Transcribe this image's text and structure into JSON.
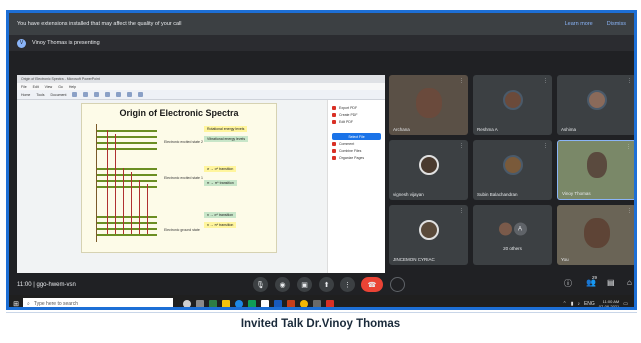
{
  "extension_bar": {
    "message": "You have extensions installed that may affect the quality of your call",
    "learn_more": "Learn more",
    "dismiss": "Dismiss"
  },
  "presenting_bar": {
    "text": "Vinoy Thomas is presenting",
    "avatar_letter": "V"
  },
  "shared_window": {
    "title": "Origin of Electronic Spectra - Microsoft PowerPoint",
    "menu": [
      "File",
      "Edit",
      "View",
      "Go",
      "Help"
    ],
    "ribbon": [
      "Home",
      "Tools",
      "Document"
    ],
    "slide_title": "Origin of Electronic Spectra",
    "tags": [
      "Rotational energy levels",
      "Vibrational energy levels",
      "σ → σ* transition",
      "π → π* transition",
      "n → σ* transition",
      "n → π* transition"
    ],
    "state_labels": [
      "Electronic excited state 2",
      "Electronic excited state 1",
      "Electronic ground state"
    ],
    "side_panel": [
      "Export PDF",
      "Create PDF",
      "Edit PDF",
      "Comment",
      "Combine Files",
      "Organize Pages"
    ],
    "side_button": "Select File"
  },
  "participants": [
    {
      "name": "Archana",
      "more": "⋮"
    },
    {
      "name": "Reshma A",
      "more": "⋮"
    },
    {
      "name": "Ashima",
      "more": "⋮"
    },
    {
      "name": "vignesh vijayan",
      "more": "⋮"
    },
    {
      "name": "Subin Balachandran",
      "more": "⋮"
    },
    {
      "name": "Vinoy Thomas",
      "more": "⋮"
    },
    {
      "name": "JINCEMON CYRIAC",
      "more": "⋮"
    },
    {
      "name": "20 others",
      "more": "",
      "badge": "A"
    },
    {
      "name": "You",
      "more": "⋮"
    }
  ],
  "meeting": {
    "time": "11:00",
    "code": "ggo-hwem-vsn"
  },
  "controls": {
    "mic_icon": "mic-icon",
    "camera_icon": "camera-icon",
    "cc_icon": "captions-icon",
    "present_icon": "present-icon",
    "more_icon": "more-icon",
    "hangup_icon": "hang-up-icon",
    "participants_count": "29"
  },
  "taskbar": {
    "search_placeholder": "Type here to search",
    "lang": "ENG",
    "time": "11:00 AM",
    "date": "07-08-2021"
  },
  "caption": "Invited Talk Dr.Vinoy Thomas",
  "colors": {
    "border": "#1d6fd6",
    "meet_bg": "#202124",
    "hangup": "#ea4335"
  }
}
